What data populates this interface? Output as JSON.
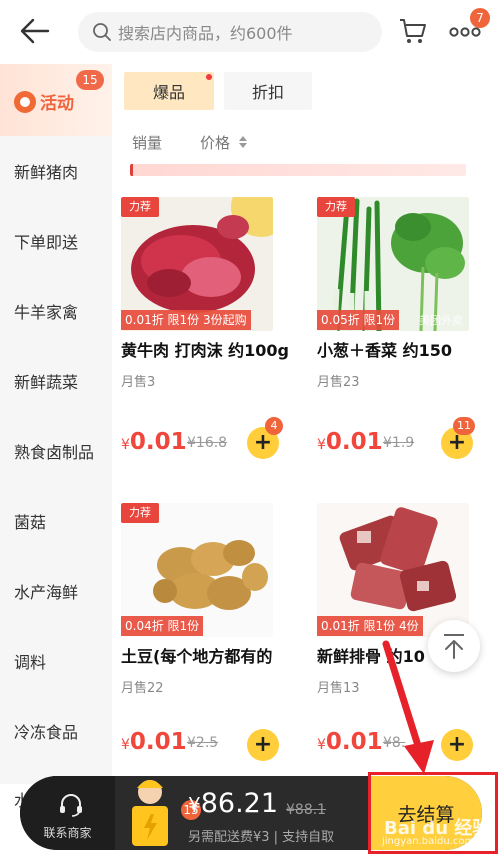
{
  "search": {
    "placeholder": "搜索店内商品，约600件"
  },
  "header": {
    "more_badge": "7"
  },
  "sidebar": {
    "active": {
      "label": "活动",
      "badge": "15"
    },
    "items": [
      {
        "label": "新鲜猪肉"
      },
      {
        "label": "下单即送"
      },
      {
        "label": "牛羊家禽"
      },
      {
        "label": "新鲜蔬菜"
      },
      {
        "label": "熟食卤制品"
      },
      {
        "label": "菌菇"
      },
      {
        "label": "水产海鲜"
      },
      {
        "label": "调料"
      },
      {
        "label": "冷冻食品"
      },
      {
        "label": "水"
      }
    ]
  },
  "filters": {
    "hot": "爆品",
    "discount": "折扣"
  },
  "sort": {
    "sales": "销量",
    "price": "价格"
  },
  "products": [
    {
      "tag": "力荐",
      "promo": "0.01折 限1份 3份起购",
      "name": "黄牛肉 打肉沫 约100g",
      "sold": "月售3",
      "currency": "¥",
      "price": "0.01",
      "original": "16.8",
      "cart_count": "4"
    },
    {
      "tag": "力荐",
      "promo": "0.05折 限1份",
      "watermark": "美团外卖",
      "name": "小葱＋香菜 约150",
      "sold": "月售23",
      "currency": "¥",
      "price": "0.01",
      "original": "1.9",
      "cart_count": "11"
    },
    {
      "tag": "力荐",
      "promo": "0.04折 限1份",
      "name": "土豆(每个地方都有的",
      "sold": "月售22",
      "currency": "¥",
      "price": "0.01",
      "original": "2.5",
      "cart_count": ""
    },
    {
      "tag": "",
      "promo": "0.01折 限1份 4份",
      "name": "新鲜排骨 约10",
      "sold": "月售13",
      "currency": "¥",
      "price": "0.01",
      "original": "8.",
      "cart_count": ""
    }
  ],
  "add_symbol": "+",
  "bottom_bar": {
    "contact_label": "联系商家",
    "cart_badge": "15",
    "currency": "¥",
    "total": "86.21",
    "total_original": "88.1",
    "fee_note": "另需配送费¥3 | 支持自取",
    "checkout_label": "去结算"
  },
  "watermark": {
    "brand": "Bai du 经验",
    "url": "jingyan.baidu.com"
  },
  "colors": {
    "accent": "#f0643c",
    "price": "#f0463c",
    "button": "#ffce3a",
    "annotation": "#e6212a"
  }
}
